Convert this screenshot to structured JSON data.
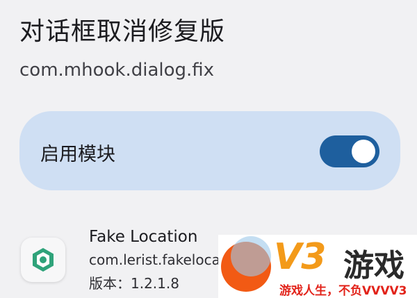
{
  "module": {
    "title": "对话框取消修复版",
    "package": "com.mhook.dialog.fix"
  },
  "enable": {
    "label": "启用模块",
    "enabled": true
  },
  "app": {
    "name": "Fake Location",
    "package": "com.lerist.fakelocation",
    "version": "版本：1.2.1.8"
  },
  "watermark": {
    "logo": "V3",
    "name": "游戏",
    "slogan": "游戏人生，不负VVVV3"
  },
  "colors": {
    "accent": "#1e5f9e",
    "card": "#cfdff3",
    "background": "#f1f1f3"
  }
}
